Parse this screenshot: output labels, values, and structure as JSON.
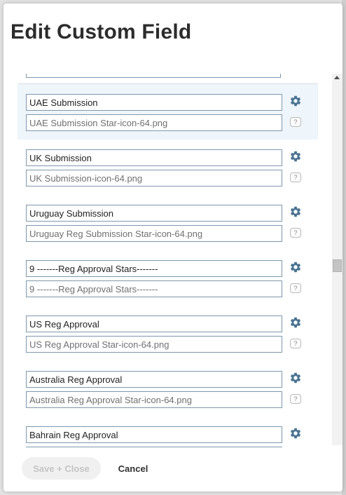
{
  "dialog": {
    "title": "Edit Custom Field"
  },
  "fields": [
    {
      "name": "UAE Submission",
      "icon": "UAE Submission Star-icon-64.png",
      "selected": true
    },
    {
      "name": "UK Submission",
      "icon": "UK Submission-icon-64.png",
      "selected": false
    },
    {
      "name": "Uruguay Submission",
      "icon": "Uruguay Reg Submission Star-icon-64.png",
      "selected": false
    },
    {
      "name": "9 -------Reg Approval Stars-------",
      "icon": "9 -------Reg Approval Stars-------",
      "selected": false
    },
    {
      "name": "US Reg Approval",
      "icon": "US Reg Approval Star-icon-64.png",
      "selected": false
    },
    {
      "name": "Australia Reg Approval",
      "icon": "Australia Reg Approval Star-icon-64.png",
      "selected": false
    },
    {
      "name": "Bahrain Reg Approval",
      "icon": "",
      "selected": false
    }
  ],
  "help_label": "?",
  "footer": {
    "save_label": "Save + Close",
    "cancel_label": "Cancel"
  },
  "icons": {
    "settings": "gear-icon",
    "help": "question-icon",
    "scroll_up": "chevron-up-icon"
  },
  "colors": {
    "gear": "#4a7391",
    "input_border": "#7d98ad",
    "selected_row": "#eef5fb",
    "disabled_button_text": "#c4c4c4"
  }
}
